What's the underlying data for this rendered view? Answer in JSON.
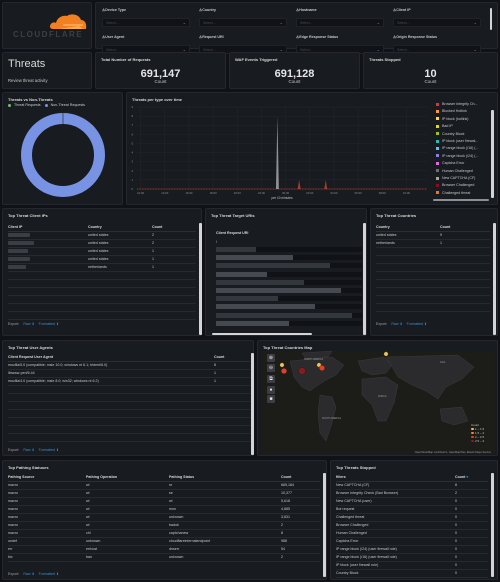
{
  "logo": {
    "text": "CLOUDFLARE",
    "color": "#f38020"
  },
  "filters": [
    {
      "label": "Device Type",
      "placeholder": "Select..."
    },
    {
      "label": "Country",
      "placeholder": "Select..."
    },
    {
      "label": "Hostname",
      "placeholder": "Select..."
    },
    {
      "label": "Client IP",
      "placeholder": "Select..."
    },
    {
      "label": "User Agent",
      "placeholder": "Select..."
    },
    {
      "label": "Request URI",
      "placeholder": "Select..."
    },
    {
      "label": "Edge Response Status",
      "placeholder": "Select..."
    },
    {
      "label": "Origin Response Status",
      "placeholder": "Select..."
    }
  ],
  "header": {
    "title": "Threats",
    "subtitle": "Review threat activity"
  },
  "stats": [
    {
      "title": "Total Number of Requests",
      "value": "691,147",
      "unit": "Count"
    },
    {
      "title": "WAF Events Triggered",
      "value": "691,128",
      "unit": "Count"
    },
    {
      "title": "Threats Stopped",
      "value": "10",
      "unit": "Count"
    }
  ],
  "donut": {
    "title": "Threats vs Non-Threats",
    "legend": [
      {
        "label": "Threat Requests",
        "color": "#73bf69"
      },
      {
        "label": "Non-Threat Requests",
        "color": "#7893e4"
      }
    ]
  },
  "timechart": {
    "title": "Threats per type over time",
    "xlabel": "per 10 minutes",
    "legend": [
      {
        "label": "Browser Integrity Ch...",
        "color": "#e02f44"
      },
      {
        "label": "Blocked Hotlink",
        "color": "#ff9830"
      },
      {
        "label": "IP block (hotlink)",
        "color": "#fade2a"
      },
      {
        "label": "Bad IP",
        "color": "#e0e000"
      },
      {
        "label": "Country Block",
        "color": "#9ac12c"
      },
      {
        "label": "IP block (user firewal...",
        "color": "#2fb9b0"
      },
      {
        "label": "IP range block (/16) (...",
        "color": "#5ac4f0"
      },
      {
        "label": "IP range block (/24) (...",
        "color": "#8f7fe0"
      },
      {
        "label": "Captcha Error",
        "color": "#de6ade"
      },
      {
        "label": "Human Challenged",
        "color": "#6e6e6e"
      },
      {
        "label": "New CAPTCHA (CF)",
        "color": "#a6a6a6"
      },
      {
        "label": "Browser Challenged",
        "color": "#8b0e1a"
      },
      {
        "label": "Challenged threat",
        "color": "#e0752d"
      }
    ]
  },
  "chart_data": [
    {
      "type": "pie",
      "title": "Threats vs Non-Threats",
      "categories": [
        "Threat Requests",
        "Non-Threat Requests"
      ],
      "values": [
        10,
        691137
      ],
      "donut": true
    },
    {
      "type": "area",
      "title": "Threats per type over time",
      "xlabel": "per 10 minutes",
      "ylabel": "",
      "x_ticks": [
        "12:00",
        "14:00",
        "16:00",
        "18:00",
        "20:00",
        "22:00",
        "00:00",
        "02:00",
        "04:00",
        "06:00",
        "08:00",
        "10:00"
      ],
      "y_ticks": [
        0,
        1,
        2,
        3,
        4,
        5,
        6,
        7,
        8,
        9
      ],
      "ylim": [
        0,
        9
      ],
      "xlim_hours": [
        0,
        24
      ],
      "series": [
        {
          "name": "New CAPTCHA (CF)",
          "color": "#a6a6a6",
          "points": [
            [
              11.5,
              0
            ],
            [
              11.62,
              8
            ],
            [
              11.74,
              0
            ]
          ]
        },
        {
          "name": "Browser Integrity Check",
          "color": "#c4402f",
          "points": [
            [
              13.3,
              0
            ],
            [
              13.42,
              1
            ],
            [
              13.54,
              0
            ]
          ]
        },
        {
          "name": "Browser Integrity Check",
          "color": "#c4402f",
          "points": [
            [
              15.5,
              0
            ],
            [
              15.62,
              1
            ],
            [
              15.74,
              0
            ]
          ]
        }
      ],
      "grid": true,
      "legend": "right"
    },
    {
      "type": "scatter",
      "title": "Top Threat Countries Map",
      "legend_title": "Count",
      "legend": [
        {
          "label": "1 – 1.5",
          "color": "#e8c35a"
        },
        {
          "label": "1.5 – 2",
          "color": "#f08a33"
        },
        {
          "label": "2 – 2.5",
          "color": "#e0402a"
        },
        {
          "label": "2.5 – 3",
          "color": "#8b1a1a"
        }
      ]
    }
  ],
  "client_ips": {
    "title": "Top Threat Client IPs",
    "columns": [
      "Client IP",
      "Country",
      "Count"
    ],
    "rows": [
      {
        "country": "united states",
        "count": "2"
      },
      {
        "country": "united states",
        "count": "2"
      },
      {
        "country": "united states",
        "count": "1"
      },
      {
        "country": "united states",
        "count": "1"
      },
      {
        "country": "netherlands",
        "count": "1"
      }
    ]
  },
  "target_uris": {
    "title": "Top Threat Target URIs",
    "columns": [
      "Client Request URI"
    ],
    "first_row": "/"
  },
  "countries": {
    "title": "Top Threat Countries",
    "columns": [
      "Country",
      "Count"
    ],
    "rows": [
      {
        "country": "united states",
        "count": "9"
      },
      {
        "country": "netherlands",
        "count": "1"
      }
    ]
  },
  "export": {
    "label": "Export:",
    "raw": "Raw",
    "formatted": "Formatted"
  },
  "user_agents": {
    "title": "Top Threat User Agents",
    "columns": [
      "Client Request User Agent",
      "Count"
    ],
    "rows": [
      {
        "ua": "mozilla/5.0 (compatible; msie 10.0; windows nt 6.1; trident/6.0)",
        "count": "8"
      },
      {
        "ua": "libwww-perl/6.44",
        "count": "1"
      },
      {
        "ua": "mozilla/4.0 (compatible; msie 8.0; win32; windows nt 6.2)",
        "count": "1"
      }
    ]
  },
  "map": {
    "title": "Top Threat Countries Map",
    "labels": {
      "na": "NORTH AMERICA",
      "sa": "SOUTH AMERICA",
      "africa": "AFRICA",
      "asia": "ASIA"
    },
    "attribution": "OpenStreetMap contributors, OpenMapTiles, Elastic Maps Service",
    "legend_title": "Count",
    "legend": [
      "1 – 1.5",
      "1.5 – 2",
      "2 – 2.5",
      "2.5 – 3"
    ]
  },
  "pathing": {
    "title": "Top Pathing Statuses",
    "columns": [
      "Pathing Source",
      "Pathing Operation",
      "Pathing Status",
      "Count"
    ],
    "rows": [
      {
        "src": "macro",
        "op": "wl",
        "status": "nr",
        "count": "665,184"
      },
      {
        "src": "macro",
        "op": "wl",
        "status": "se",
        "count": "10,377"
      },
      {
        "src": "macro",
        "op": "wl",
        "status": "wl",
        "count": "5,618"
      },
      {
        "src": "macro",
        "op": "wl",
        "status": "mon",
        "count": "4,885"
      },
      {
        "src": "macro",
        "op": "wl",
        "status": "unknown",
        "count": "3,831"
      },
      {
        "src": "macro",
        "op": "wl",
        "status": "badok",
        "count": "2"
      },
      {
        "src": "macro",
        "op": "chl",
        "status": "captchanew",
        "count": "8"
      },
      {
        "src": "undef",
        "op": "unknown",
        "status": "cloudflareinternalendpoint",
        "count": "988"
      },
      {
        "src": "err",
        "op": "errhost",
        "status": "dnserr",
        "count": "54"
      },
      {
        "src": "bic",
        "op": "ban",
        "status": "unknown",
        "count": "2"
      }
    ]
  },
  "threats_stopped": {
    "title": "Top Threats Stopped",
    "columns": [
      "filters",
      "Count"
    ],
    "rows": [
      {
        "name": "New CAPTCHA (CF)",
        "count": "8"
      },
      {
        "name": "Browser Integrity Check (Bad Browser)",
        "count": "2"
      },
      {
        "name": "New CAPTCHA (user)",
        "count": "0"
      },
      {
        "name": "Bot request",
        "count": "0"
      },
      {
        "name": "Challenged threat",
        "count": "0"
      },
      {
        "name": "Browser Challenged",
        "count": "0"
      },
      {
        "name": "Human Challenged",
        "count": "0"
      },
      {
        "name": "Captcha Error",
        "count": "0"
      },
      {
        "name": "IP range block (/24) (user firewall rule)",
        "count": "0"
      },
      {
        "name": "IP range block (/16) (user firewall rule)",
        "count": "0"
      },
      {
        "name": "IP block (user firewall rule)",
        "count": "0"
      },
      {
        "name": "Country Block",
        "count": "0"
      }
    ]
  }
}
